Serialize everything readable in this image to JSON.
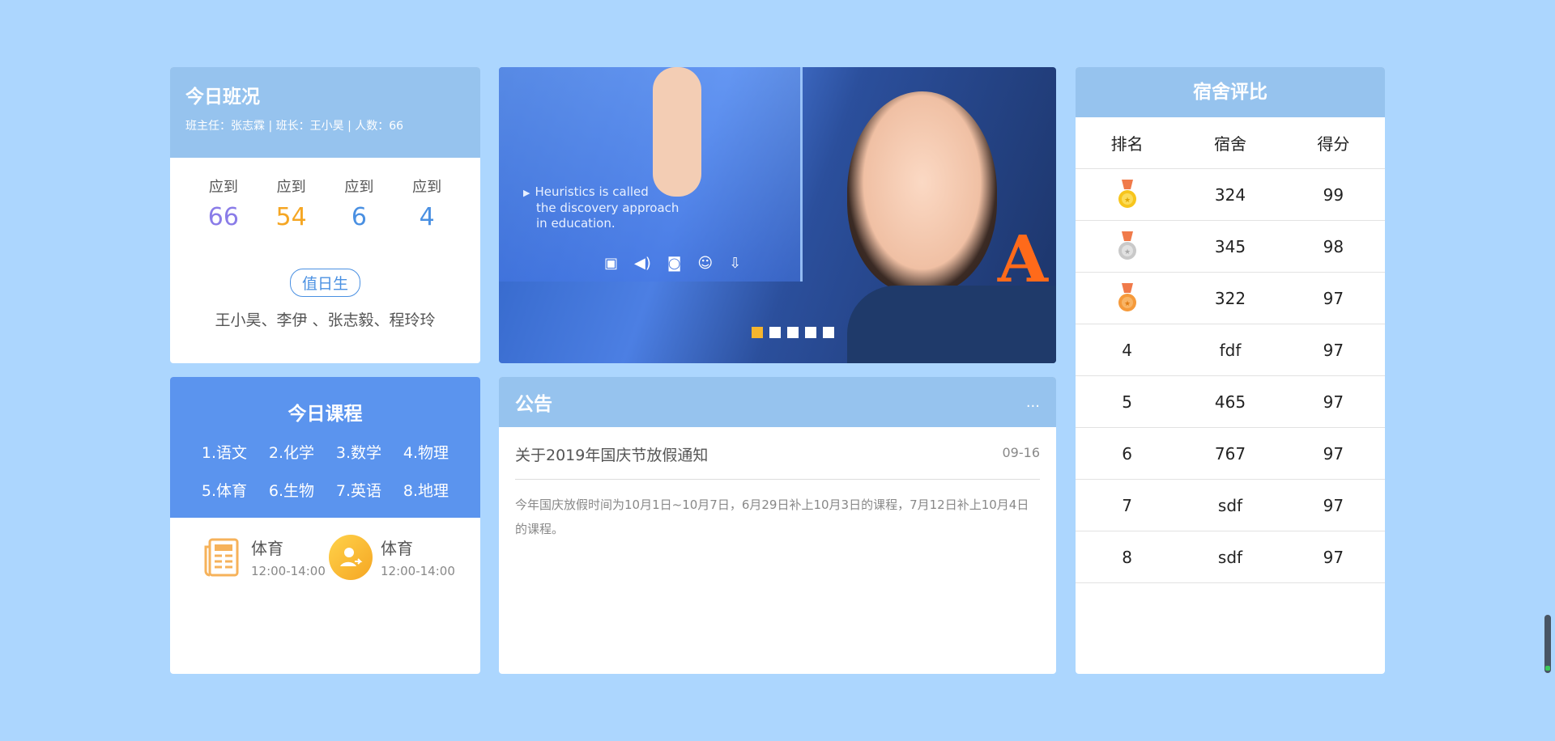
{
  "today_class": {
    "title": "今日班况",
    "subtitle": "班主任：张志霖 | 班长：王小昊 | 人数：66",
    "stats": [
      {
        "label": "应到",
        "value": "66",
        "color": "#8a7ce8"
      },
      {
        "label": "应到",
        "value": "54",
        "color": "#f5a623"
      },
      {
        "label": "应到",
        "value": "6",
        "color": "#4a90e2"
      },
      {
        "label": "应到",
        "value": "4",
        "color": "#4a90e2"
      }
    ],
    "duty_label": "值日生",
    "duty_names": "王小昊、李伊 、张志毅、程玲玲"
  },
  "today_courses": {
    "title": "今日课程",
    "courses": [
      "1.语文",
      "2.化学",
      "3.数学",
      "4.物理",
      "5.体育",
      "6.生物",
      "7.英语",
      "8.地理"
    ],
    "current": [
      {
        "name": "体育",
        "time": "12:00-14:00",
        "icon": "newspaper-icon"
      },
      {
        "name": "体育",
        "time": "12:00-14:00",
        "icon": "user-swap-icon"
      }
    ]
  },
  "banner": {
    "text_lines": [
      "Heuristics is called",
      "the discovery approach",
      "in education."
    ],
    "slide_count": 5,
    "active_slide": 0,
    "accent_color": "#f5b52e"
  },
  "notice": {
    "title": "公告",
    "more": "...",
    "items": [
      {
        "title": "关于2019年国庆节放假通知",
        "date": "09-16",
        "body": "今年国庆放假时间为10月1日~10月7日，6月29日补上10月3日的课程，7月12日补上10月4日的课程。"
      }
    ]
  },
  "dorm": {
    "title": "宿舍评比",
    "headers": [
      "排名",
      "宿舍",
      "得分"
    ],
    "rows": [
      {
        "rank": "",
        "medal": "gold",
        "room": "324",
        "score": "99"
      },
      {
        "rank": "",
        "medal": "silver",
        "room": "345",
        "score": "98"
      },
      {
        "rank": "",
        "medal": "bronze",
        "room": "322",
        "score": "97"
      },
      {
        "rank": "4",
        "medal": "",
        "room": "fdf",
        "score": "97"
      },
      {
        "rank": "5",
        "medal": "",
        "room": "465",
        "score": "97"
      },
      {
        "rank": "6",
        "medal": "",
        "room": "767",
        "score": "97"
      },
      {
        "rank": "7",
        "medal": "",
        "room": "sdf",
        "score": "97"
      },
      {
        "rank": "8",
        "medal": "",
        "room": "sdf",
        "score": "97"
      }
    ]
  },
  "colors": {
    "page_bg": "#acd6fe",
    "header_light": "#96c3ee",
    "header_blue": "#5b94ee"
  }
}
